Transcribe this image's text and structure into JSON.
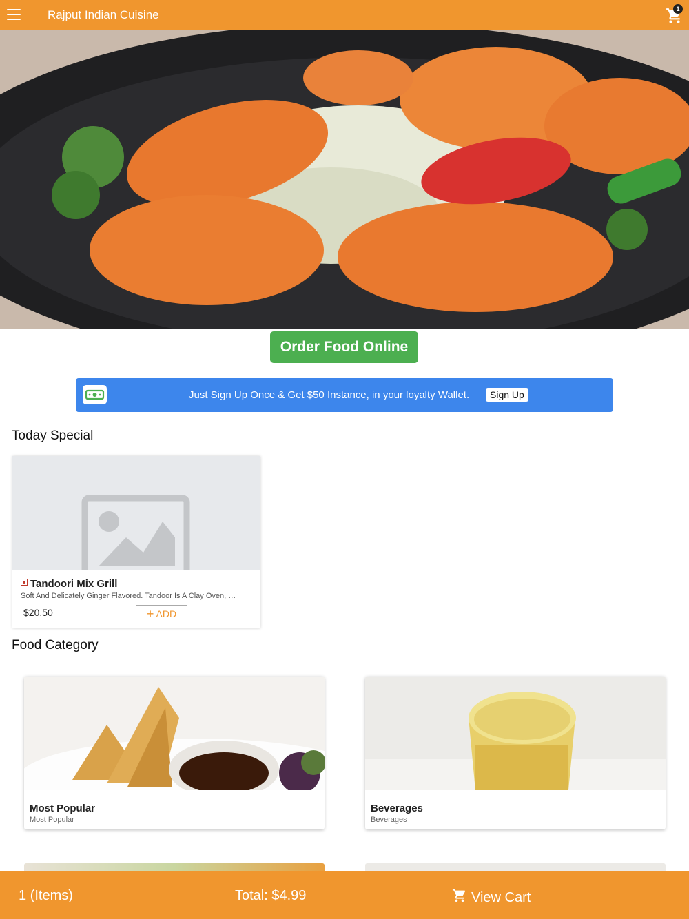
{
  "header": {
    "title": "Rajput Indian Cuisine",
    "cart_count": "1",
    "menu_icon": "hamburger-menu-icon",
    "cart_icon": "shopping-cart-icon",
    "bar_color": "#f0962e"
  },
  "hero": {
    "image": "tandoori-chicken-photo"
  },
  "order_button": {
    "label": "Order Food Online",
    "color": "#4caf50"
  },
  "loyalty": {
    "text": "Just Sign Up Once & Get $50 Instance, in your loyalty Wallet.",
    "button": "Sign Up",
    "icon": "money-bill-icon",
    "color": "#3d86ec"
  },
  "today_special": {
    "title": "Today Special",
    "items": [
      {
        "name": "Tandoori Mix Grill",
        "description": "Soft And Delicately Ginger Flavored. Tandoor Is A Clay Oven, …",
        "price": "$20.50",
        "add_label": "ADD",
        "image": "image-placeholder-icon"
      }
    ]
  },
  "food_category": {
    "title": "Food Category",
    "items": [
      {
        "name": "Most Popular",
        "subtitle": "Most Popular",
        "image": "samosa-photo"
      },
      {
        "name": "Beverages",
        "subtitle": "Beverages",
        "image": "mango-lassi-photo"
      }
    ]
  },
  "bottom_bar": {
    "items": "1 (Items)",
    "total": "Total: $4.99",
    "view_cart": "View Cart"
  }
}
